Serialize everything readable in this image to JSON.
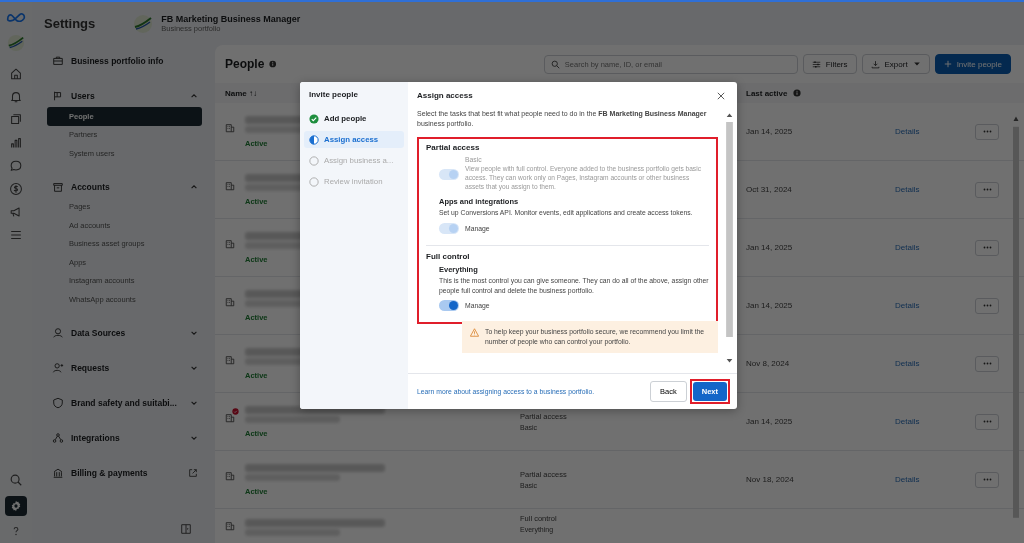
{
  "header": {
    "section": "Settings",
    "business_name": "FB Marketing Business Manager",
    "business_subtitle": "Business portfolio"
  },
  "sidebar": {
    "items": [
      {
        "label": "Business portfolio info",
        "kind": "link"
      },
      {
        "label": "Users",
        "kind": "group",
        "expanded": true,
        "children": [
          {
            "label": "People",
            "selected": true
          },
          {
            "label": "Partners",
            "selected": false
          },
          {
            "label": "System users",
            "selected": false
          }
        ]
      },
      {
        "label": "Accounts",
        "kind": "group",
        "expanded": true,
        "children": [
          {
            "label": "Pages",
            "selected": false
          },
          {
            "label": "Ad accounts",
            "selected": false
          },
          {
            "label": "Business asset groups",
            "selected": false
          },
          {
            "label": "Apps",
            "selected": false
          },
          {
            "label": "Instagram accounts",
            "selected": false
          },
          {
            "label": "WhatsApp accounts",
            "selected": false
          }
        ]
      },
      {
        "label": "Data Sources",
        "kind": "group",
        "expanded": false
      },
      {
        "label": "Requests",
        "kind": "group",
        "expanded": false
      },
      {
        "label": "Brand safety and suitabi...",
        "kind": "group",
        "expanded": false
      },
      {
        "label": "Integrations",
        "kind": "group",
        "expanded": false
      },
      {
        "label": "Billing & payments",
        "kind": "external"
      }
    ]
  },
  "main": {
    "title": "People",
    "search": {
      "placeholder": "Search by name, ID, or email"
    },
    "buttons": [
      {
        "label": "Filters",
        "kind": "filters"
      },
      {
        "label": "Export",
        "kind": "export"
      },
      {
        "label": "Invite people",
        "kind": "primary"
      }
    ],
    "table": {
      "columns": [
        "Name ↑↓",
        "Last active"
      ],
      "rows": [
        {
          "status": "Active",
          "last_active": "Jan 14, 2025",
          "action": "Details",
          "alert": false
        },
        {
          "status": "Active",
          "last_active": "Oct 31, 2024",
          "action": "Details",
          "alert": false
        },
        {
          "status": "Active",
          "last_active": "Jan 14, 2025",
          "action": "Details",
          "alert": false
        },
        {
          "status": "Active",
          "last_active": "Jan 14, 2025",
          "action": "Details",
          "alert": false
        },
        {
          "status": "Active",
          "last_active": "Nov 8, 2024",
          "action": "Details",
          "alert": false
        },
        {
          "status": "Active",
          "access": "Partial access",
          "access_detail": "Basic",
          "last_active": "Jan 14, 2025",
          "action": "Details",
          "alert": true
        },
        {
          "status": "Active",
          "access": "Partial access",
          "access_detail": "Basic",
          "last_active": "Nov 18, 2024",
          "action": "Details",
          "alert": false
        },
        {
          "access": "Full control",
          "access_detail": "Everything",
          "alert": false
        }
      ]
    }
  },
  "modal": {
    "title": "Invite people",
    "steps": [
      {
        "label": "Add people",
        "completed": true,
        "selected": false
      },
      {
        "label": "Assign access",
        "completed": false,
        "selected": true
      },
      {
        "label": "Assign business a...",
        "completed": false,
        "selected": false
      },
      {
        "label": "Review invitation",
        "completed": false,
        "selected": false
      }
    ],
    "panel_title": "Assign access",
    "intro": "Select the tasks that best fit what people need to do in the **FB Marketing Business Manager** business portfolio.",
    "sections": [
      {
        "heading": "Partial access",
        "permissions": [
          {
            "kind": "inline",
            "title": "Basic",
            "description": "View people with full control. Everyone added to the business portfolio gets basic access. They can work only on Pages, Instagram accounts or other business assets that you assign to them.",
            "on": true,
            "disabled": true
          },
          {
            "kind": "stacked",
            "title": "Apps and integrations",
            "description": "Set up Conversions API. Monitor events, edit applications and create access tokens.",
            "toggle_label": "Manage",
            "on": true,
            "disabled": true
          }
        ]
      },
      {
        "heading": "Full control",
        "permissions": [
          {
            "kind": "stacked",
            "title": "Everything",
            "description": "This is the most control you can give someone. They can do all of the above, assign other people full control and delete the business portfolio.",
            "toggle_label": "Manage",
            "on": true,
            "disabled": false
          }
        ]
      }
    ],
    "warning": "To help keep your business portfolio secure, we recommend you limit the number of people who can control your portfolio.",
    "footer": {
      "link": "Learn more about assigning access to a business portfolio.",
      "back": "Back",
      "next": "Next"
    }
  }
}
